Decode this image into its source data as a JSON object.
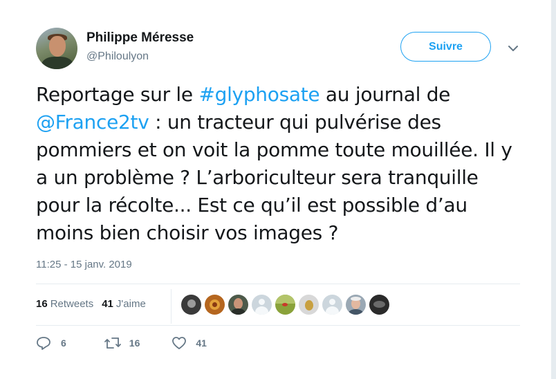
{
  "author": {
    "name": "Philippe Méresse",
    "handle": "@Philoulyon"
  },
  "follow_button": {
    "label": "Suivre"
  },
  "tweet": {
    "parts": [
      "Reportage sur le ",
      "#glyphosate",
      " au journal de ",
      "@France2tv",
      " : un tracteur qui pulvérise des pommiers et on voit la pomme toute mouillée. Il y a un problème ? L’arboriculteur sera tranquille pour la récolte... Est ce qu’il est possible d’au moins bien choisir vos images ?"
    ],
    "timestamp": "11:25 - 15 janv. 2019"
  },
  "stats": {
    "retweets_count": "16",
    "retweets_label": "Retweets",
    "likes_count": "41",
    "likes_label": "J'aime"
  },
  "actions": {
    "replies": "6",
    "retweets": "16",
    "likes": "41"
  },
  "colors": {
    "accent": "#1da1f2",
    "secondary_text": "#657786",
    "primary_text": "#14171a"
  },
  "likers_avatars": [
    "avatar-1",
    "avatar-2",
    "avatar-3",
    "avatar-4",
    "avatar-5",
    "avatar-6",
    "avatar-7",
    "avatar-8",
    "avatar-9"
  ]
}
